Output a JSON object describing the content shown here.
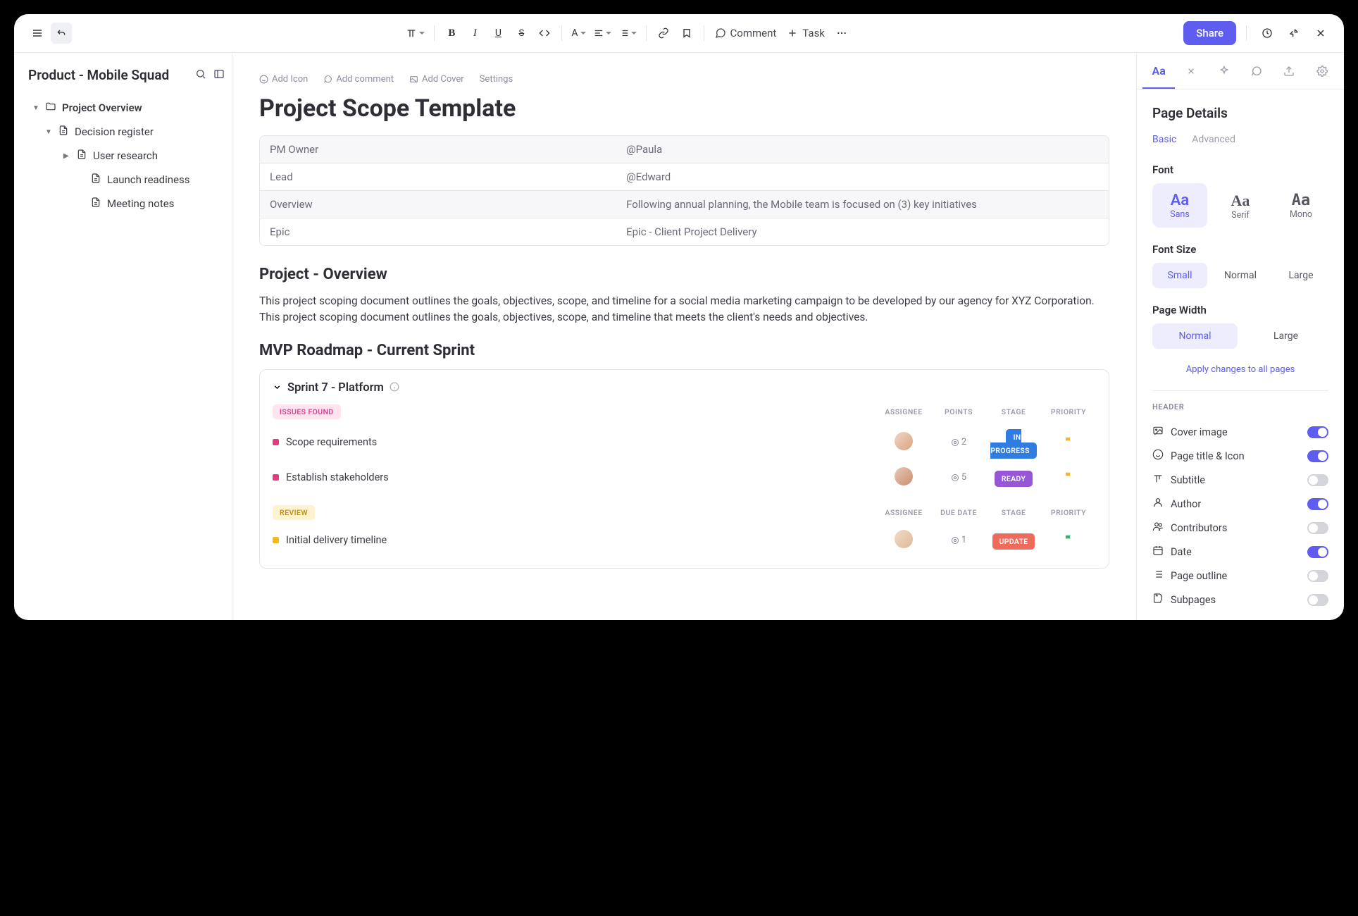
{
  "toolbar": {
    "comment": "Comment",
    "task": "Task",
    "share": "Share"
  },
  "sidebar": {
    "title": "Product - Mobile Squad",
    "tree": [
      {
        "label": "Project Overview",
        "type": "folder",
        "indent": 0,
        "expanded": true
      },
      {
        "label": "Decision register",
        "type": "page",
        "indent": 1,
        "expanded": true
      },
      {
        "label": "User research",
        "type": "page",
        "indent": 2,
        "expanded": false
      },
      {
        "label": "Launch readiness",
        "type": "page",
        "indent": 3
      },
      {
        "label": "Meeting notes",
        "type": "page",
        "indent": 3
      }
    ]
  },
  "doc": {
    "meta": {
      "addIcon": "Add Icon",
      "addComment": "Add comment",
      "addCover": "Add Cover",
      "settings": "Settings"
    },
    "title": "Project Scope Template",
    "info": [
      {
        "k": "PM Owner",
        "v": "@Paula"
      },
      {
        "k": "Lead",
        "v": "@Edward"
      },
      {
        "k": "Overview",
        "v": "Following annual planning, the Mobile team is focused on (3) key initiatives"
      },
      {
        "k": "Epic",
        "v": "Epic - Client Project Delivery"
      }
    ],
    "h2a": "Project - Overview",
    "p1": "This project scoping document outlines the goals, objectives, scope, and timeline for a social media marketing campaign to be developed by our agency for XYZ Corporation. This project scoping document outlines the goals, objectives, scope, and timeline that meets the client's needs and objectives.",
    "h2b": "MVP Roadmap - Current Sprint",
    "sprint": {
      "title": "Sprint  7 - Platform",
      "groups": [
        {
          "label": "ISSUES FOUND",
          "class": "group-pink",
          "cols": [
            "ASSIGNEE",
            "POINTS",
            "STAGE",
            "PRIORITY"
          ],
          "tasks": [
            {
              "name": "Scope requirements",
              "points": "2",
              "stage": "IN PROGRESS",
              "stageClass": "stage-blue",
              "flag": "y",
              "sq": "sq-pink"
            },
            {
              "name": "Establish stakeholders",
              "points": "5",
              "stage": "READY",
              "stageClass": "stage-purple",
              "flag": "y",
              "sq": "sq-pink"
            }
          ]
        },
        {
          "label": "REVIEW",
          "class": "group-yellow",
          "cols": [
            "ASSIGNEE",
            "DUE DATE",
            "STAGE",
            "PRIORITY"
          ],
          "tasks": [
            {
              "name": "Initial delivery timeline",
              "points": "1",
              "stage": "UPDATE",
              "stageClass": "stage-red",
              "flag": "g",
              "sq": "sq-yellow"
            }
          ]
        }
      ]
    }
  },
  "panel": {
    "title": "Page Details",
    "subtabs": {
      "basic": "Basic",
      "advanced": "Advanced"
    },
    "fontLabel": "Font",
    "fonts": [
      {
        "aa": "Aa",
        "label": "Sans",
        "active": true,
        "cls": ""
      },
      {
        "aa": "Aa",
        "label": "Serif",
        "active": false,
        "cls": "serif"
      },
      {
        "aa": "Aa",
        "label": "Mono",
        "active": false,
        "cls": "mono"
      }
    ],
    "sizeLabel": "Font Size",
    "sizes": [
      {
        "label": "Small",
        "active": true
      },
      {
        "label": "Normal",
        "active": false
      },
      {
        "label": "Large",
        "active": false
      }
    ],
    "widthLabel": "Page Width",
    "widths": [
      {
        "label": "Normal",
        "active": true
      },
      {
        "label": "Large",
        "active": false
      }
    ],
    "applyAll": "Apply changes to all pages",
    "headerSection": "HEADER",
    "toggles": [
      {
        "label": "Cover image",
        "on": true,
        "icon": "image"
      },
      {
        "label": "Page title & Icon",
        "on": true,
        "icon": "smile"
      },
      {
        "label": "Subtitle",
        "on": false,
        "icon": "text"
      },
      {
        "label": "Author",
        "on": true,
        "icon": "user"
      },
      {
        "label": "Contributors",
        "on": false,
        "icon": "users"
      },
      {
        "label": "Date",
        "on": true,
        "icon": "calendar"
      },
      {
        "label": "Page outline",
        "on": false,
        "icon": "list"
      },
      {
        "label": "Subpages",
        "on": false,
        "icon": "pages"
      }
    ]
  }
}
